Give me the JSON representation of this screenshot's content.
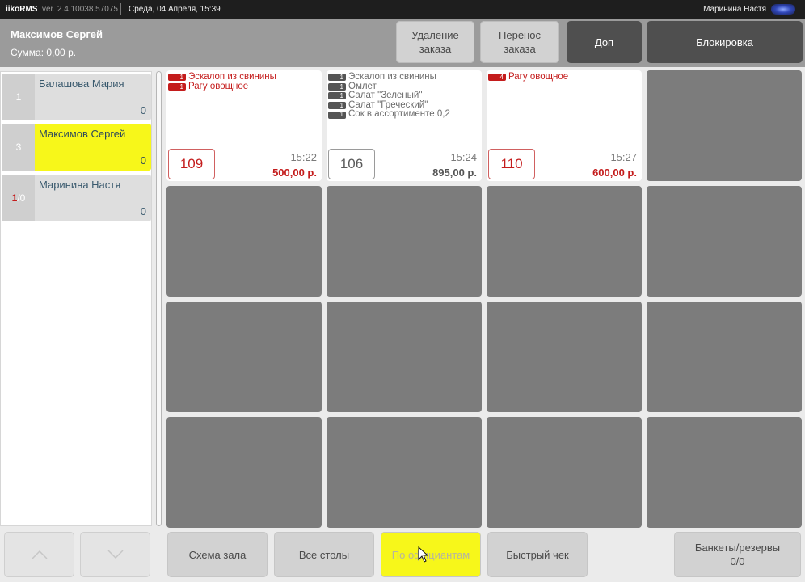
{
  "titlebar": {
    "app": "iikoRMS",
    "version": "ver. 2.4.10038.57075",
    "datetime": "Среда, 04 Апреля, 15:39",
    "user": "Маринина Настя"
  },
  "header": {
    "waiter": "Максимов Сергей",
    "sum": "Сумма: 0,00 р.",
    "delete_order": [
      "Удаление",
      "заказа"
    ],
    "transfer_order": [
      "Перенос",
      "заказа"
    ],
    "extra": "Доп",
    "lock": "Блокировка"
  },
  "waiters": [
    {
      "num": "1",
      "name": "Балашова Мария",
      "count": "0"
    },
    {
      "num": "3",
      "name": "Максимов Сергей",
      "count": "0"
    },
    {
      "num_red": "1",
      "num_rest": "/0",
      "name": "Маринина Настя",
      "count": "0"
    }
  ],
  "orders": [
    {
      "table": "109",
      "time": "15:22",
      "sum": "500,00 р.",
      "items": [
        {
          "qty": "1",
          "name": "Эскалоп из свинины"
        },
        {
          "qty": "1",
          "name": "Рагу овощное"
        }
      ]
    },
    {
      "table": "106",
      "time": "15:24",
      "sum": "895,00 р.",
      "items": [
        {
          "qty": "1",
          "name": "Эскалоп из свинины"
        },
        {
          "qty": "1",
          "name": "Омлет"
        },
        {
          "qty": "1",
          "name": "Салат \"Зеленый\""
        },
        {
          "qty": "1",
          "name": "Салат \"Греческий\""
        },
        {
          "qty": "1",
          "name": "Сок в ассортименте 0,2"
        }
      ]
    },
    {
      "table": "110",
      "time": "15:27",
      "sum": "600,00 р.",
      "items": [
        {
          "qty": "4",
          "name": "Рагу овощное"
        }
      ]
    }
  ],
  "bottom": {
    "up_icon": "chevron-up-icon",
    "down_icon": "chevron-down-icon",
    "hall_scheme": "Схема зала",
    "all_tables": "Все столы",
    "by_waiters": "По официантам",
    "quick_check": "Быстрый чек",
    "banquets": [
      "Банкеты/резервы",
      "0/0"
    ]
  },
  "colors": {
    "highlight": "#f7f71a",
    "accent_red": "#c41c1c",
    "empty_tile": "#7c7c7c",
    "header": "#9b9b9b"
  }
}
